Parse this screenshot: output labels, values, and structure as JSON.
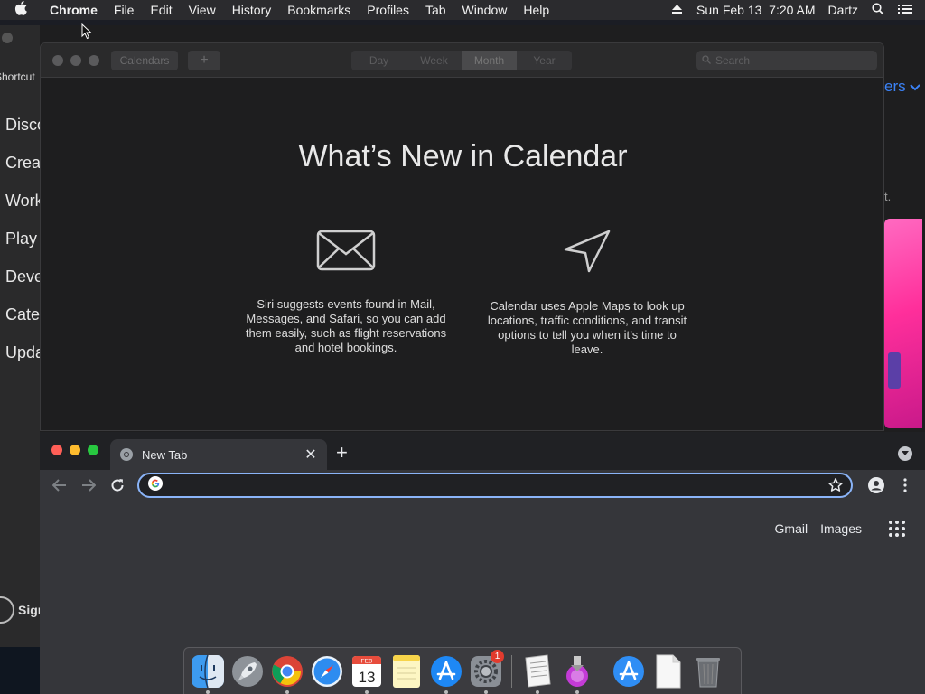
{
  "menubar": {
    "app_name": "Chrome",
    "items": [
      "File",
      "Edit",
      "View",
      "History",
      "Bookmarks",
      "Profiles",
      "Tab",
      "Window",
      "Help"
    ],
    "datetime": "Sun Feb 13  7:20 AM",
    "user": "Dartz"
  },
  "appstore": {
    "shortcut_label": "Shortcut",
    "sidebar_items": [
      "Disco",
      "Crea",
      "Work",
      "Play",
      "Deve",
      "Cate",
      "Upda"
    ],
    "sign_in_label": "Sign",
    "right_label": "ers",
    "right_note": "t."
  },
  "calendar": {
    "toolbar": {
      "calendars_label": "Calendars",
      "add_label": "+",
      "views": [
        "Day",
        "Week",
        "Month",
        "Year"
      ],
      "active_view": "Month",
      "search_placeholder": "Search"
    },
    "title": "What’s New in Calendar",
    "features": [
      {
        "icon": "envelope-icon",
        "text": "Siri suggests events found in Mail, Messages, and Safari, so you can add them easily, such as flight reservations and hotel bookings."
      },
      {
        "icon": "location-arrow-icon",
        "text": "Calendar uses Apple Maps to look up locations, traffic conditions, and transit options to tell you when it’s time to leave."
      }
    ]
  },
  "chrome": {
    "tab_title": "New Tab",
    "omnibox_value": "",
    "links": {
      "gmail": "Gmail",
      "images": "Images"
    },
    "accent": "#8ab4f8"
  },
  "dock": {
    "items": [
      "finder",
      "launchpad",
      "chrome",
      "safari",
      "calendar",
      "notes",
      "app-store",
      "system-preferences",
      "textedit",
      "script-editor",
      "app-store-downloads",
      "document",
      "trash"
    ],
    "calendar_month": "FEB",
    "calendar_day": "13",
    "system_preferences_badge": "1"
  }
}
